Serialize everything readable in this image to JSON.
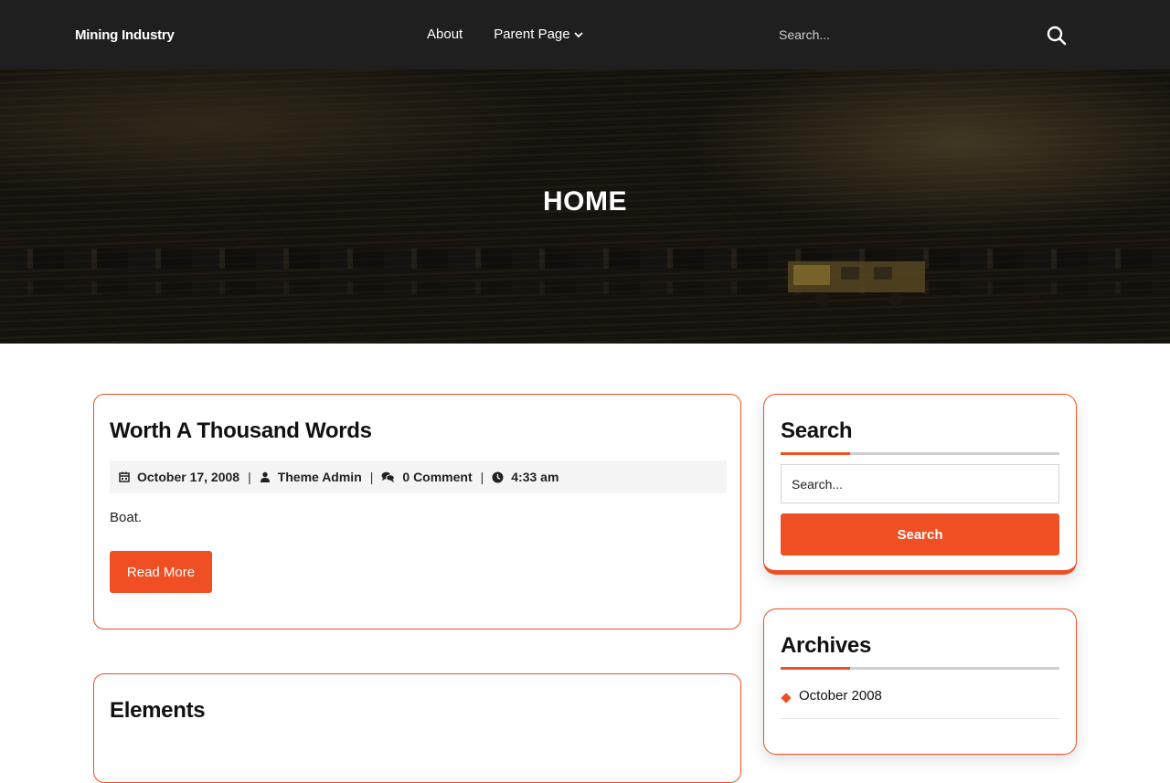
{
  "header": {
    "logo": "Mining Industry",
    "nav": [
      {
        "label": "About"
      },
      {
        "label": "Parent Page",
        "has_dropdown": true
      }
    ],
    "search_placeholder": "Search..."
  },
  "hero": {
    "title": "HOME"
  },
  "posts": [
    {
      "title": "Worth A Thousand Words",
      "date": "October 17, 2008",
      "author": "Theme Admin",
      "comments": "0 Comment",
      "time": "4:33 am",
      "excerpt": "Boat.",
      "read_more": "Read More"
    },
    {
      "title": "Elements"
    }
  ],
  "sidebar": {
    "search": {
      "title": "Search",
      "placeholder": "Search...",
      "button": "Search"
    },
    "archives": {
      "title": "Archives",
      "items": [
        "October 2008"
      ]
    }
  },
  "colors": {
    "accent": "#f04e23",
    "header_bg": "#1f1f1f"
  },
  "icons": {
    "search": "search-icon",
    "calendar": "calendar-icon",
    "user": "user-icon",
    "comments": "comments-icon",
    "clock": "clock-icon",
    "chevron": "chevron-down-icon"
  }
}
